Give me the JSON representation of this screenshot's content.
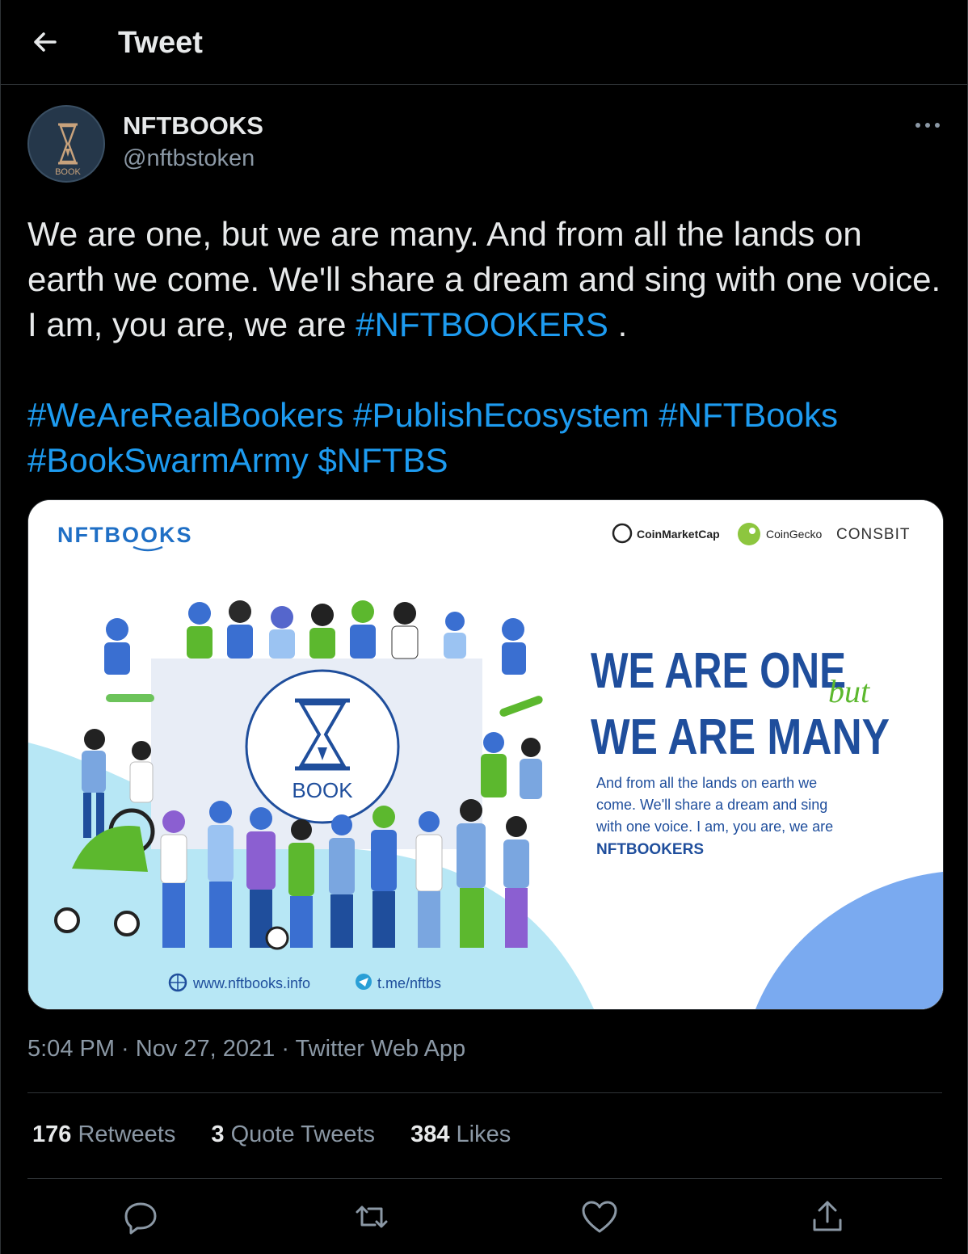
{
  "header": {
    "title": "Tweet"
  },
  "author": {
    "name": "NFTBOOKS",
    "handle": "@nftbstoken",
    "avatar_text": "BOOK"
  },
  "tweet": {
    "line1_text": "We are one, but we are many. And from all the lands on earth we come. We'll share a dream and sing with one voice. I am, you are, we are ",
    "line1_tag": "#NFTBOOKERS",
    "line1_end": " .",
    "hashtags": [
      "#WeAreRealBookers",
      "#PublishEcosystem",
      "#NFTBooks",
      "#BookSwarmArmy",
      "$NFTBS"
    ]
  },
  "media": {
    "logo": "NFTBOOKS",
    "partners": [
      "CoinMarketCap",
      "CoinGecko",
      "CONSBIT"
    ],
    "headline1": "WE ARE ONE",
    "headline_script": "but",
    "headline2": "WE ARE MANY",
    "body_lines": [
      "And from all the lands on earth we",
      "come. We'll share a dream and sing",
      "with one voice. I am, you are, we are"
    ],
    "body_bold": "NFTBOOKERS",
    "badge": "BOOK",
    "website": "www.nftbooks.info",
    "telegram": "t.me/nftbs"
  },
  "meta": {
    "time": "5:04 PM",
    "date": "Nov 27, 2021",
    "source": "Twitter Web App",
    "sep": " · "
  },
  "stats": {
    "retweets_count": "176",
    "retweets_label": "Retweets",
    "quotes_count": "3",
    "quotes_label": "Quote Tweets",
    "likes_count": "384",
    "likes_label": "Likes"
  },
  "colors": {
    "background": "#000000",
    "link": "#1d9bf0",
    "muted": "#8b98a5",
    "brand_blue": "#1f4e9c",
    "brand_green": "#5cb82e"
  },
  "icons": [
    "back-arrow-icon",
    "more-icon",
    "reply-icon",
    "retweet-icon",
    "like-icon",
    "share-icon",
    "globe-icon",
    "telegram-icon"
  ]
}
